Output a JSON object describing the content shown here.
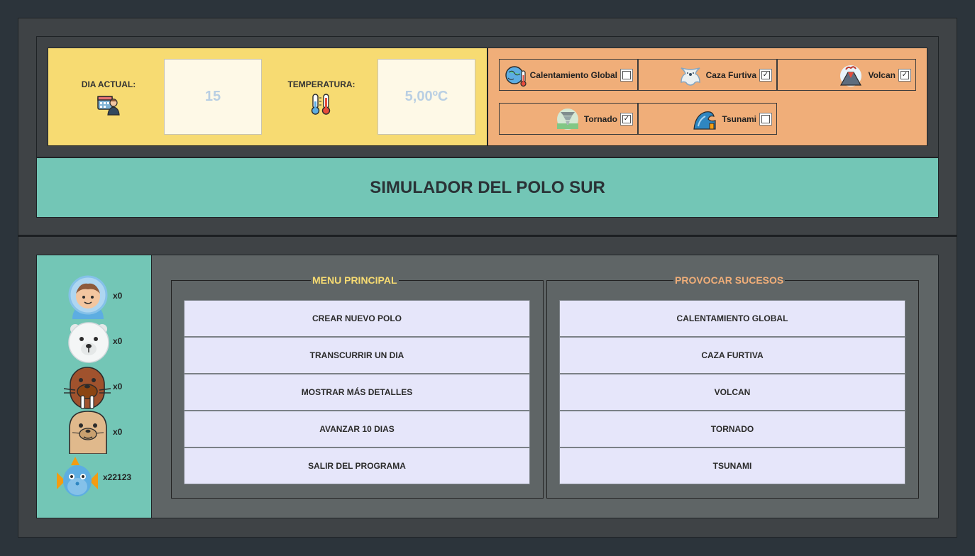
{
  "header": {
    "day_label": "DIA ACTUAL:",
    "day_value": "15",
    "temp_label": "TEMPERATURA:",
    "temp_value": "5,00ºC",
    "calendar_icon": "calendar-person-icon",
    "thermometer_icon": "thermometer-icon"
  },
  "events": [
    {
      "label": "Calentamiento Global",
      "checked": false,
      "icon": "globe-melting-icon"
    },
    {
      "label": "Caza Furtiva",
      "checked": true,
      "icon": "polar-bear-skin-icon"
    },
    {
      "label": "Volcan",
      "checked": true,
      "icon": "volcano-icon"
    },
    {
      "label": "Tornado",
      "checked": true,
      "icon": "tornado-icon"
    },
    {
      "label": "Tsunami",
      "checked": false,
      "icon": "wave-icon"
    }
  ],
  "title": "SIMULADOR DEL POLO SUR",
  "animals": [
    {
      "name": "eskimo",
      "count": "x0"
    },
    {
      "name": "polar-bear",
      "count": "x0"
    },
    {
      "name": "walrus",
      "count": "x0"
    },
    {
      "name": "seal",
      "count": "x0"
    },
    {
      "name": "fish",
      "count": "x22123"
    }
  ],
  "menu_principal": {
    "title": "MENU PRINCIPAL",
    "buttons": [
      "CREAR NUEVO POLO",
      "TRANSCURRIR UN DIA",
      "MOSTRAR MÁS DETALLES",
      "AVANZAR 10 DIAS",
      "SALIR DEL PROGRAMA"
    ]
  },
  "provocar_sucesos": {
    "title": "PROVOCAR SUCESOS",
    "buttons": [
      "CALENTAMIENTO GLOBAL",
      "CAZA FURTIVA",
      "VOLCAN",
      "TORNADO",
      "TSUNAMI"
    ]
  },
  "colors": {
    "background": "#2c343b",
    "date_panel": "#f7db72",
    "events_panel": "#f0ae79",
    "title_bar": "#73c6b6",
    "menu_title": "#f7db72",
    "sucesos_title": "#f0ae79",
    "button_bg": "#e6e6fa"
  }
}
